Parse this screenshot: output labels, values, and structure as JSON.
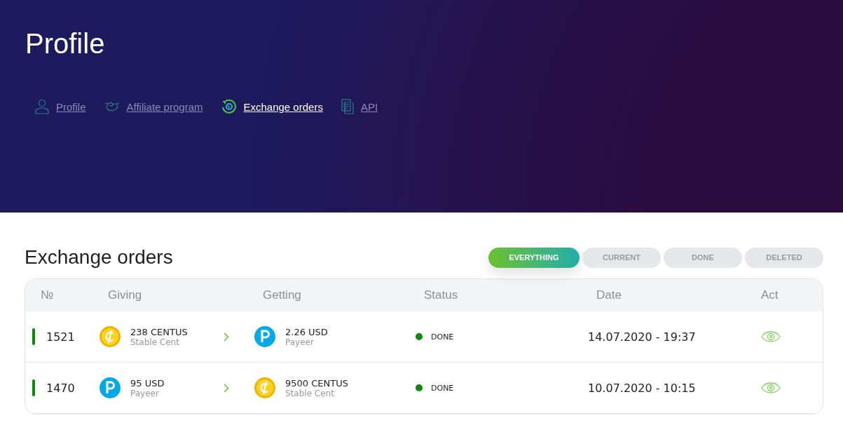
{
  "header": {
    "title": "Profile"
  },
  "nav": [
    {
      "label": "Profile",
      "kind": "user",
      "selected": false
    },
    {
      "label": "Affiliate program",
      "kind": "handshake",
      "selected": false
    },
    {
      "label": "Exchange orders",
      "kind": "exchange",
      "selected": true
    },
    {
      "label": "API",
      "kind": "document",
      "selected": false
    }
  ],
  "section": {
    "title": "Exchange orders"
  },
  "filters": [
    {
      "label": "EVERYTHING",
      "selected": true
    },
    {
      "label": "CURRENT",
      "selected": false
    },
    {
      "label": "DONE",
      "selected": false
    },
    {
      "label": "DELETED",
      "selected": false
    }
  ],
  "table": {
    "columns": [
      "№",
      "Giving",
      "Getting",
      "Status",
      "Date",
      "Act"
    ],
    "rows": [
      {
        "number": "1521",
        "color": "#0a8a0a",
        "giving": {
          "kind": "cent",
          "amount": "238 CENTUS",
          "name": "Stable Cent"
        },
        "getting": {
          "kind": "payeer",
          "amount": "2.26 USD",
          "name": "Payeer"
        },
        "status": {
          "label": "DONE",
          "color": "#0a8a0a"
        },
        "date": "14.07.2020 - 19:37"
      },
      {
        "number": "1470",
        "color": "#0a8a0a",
        "giving": {
          "kind": "payeer",
          "amount": "95 USD",
          "name": "Payeer"
        },
        "getting": {
          "kind": "cent",
          "amount": "9500 CENTUS",
          "name": "Stable Cent"
        },
        "status": {
          "label": "DONE",
          "color": "#0a8a0a"
        },
        "date": "10.07.2020 - 10:15"
      }
    ]
  }
}
